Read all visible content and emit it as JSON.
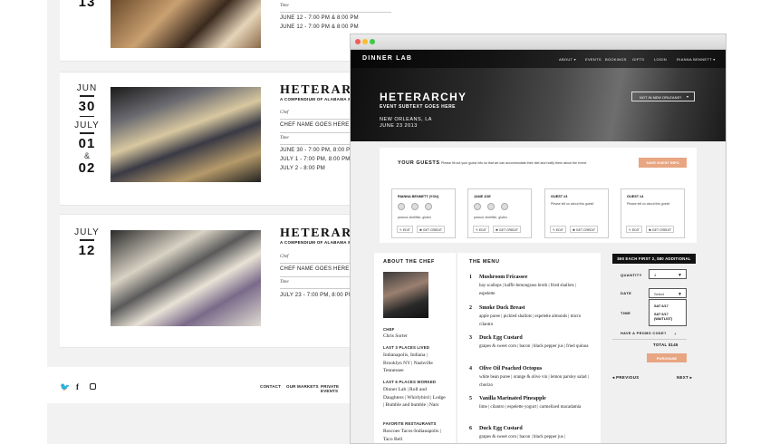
{
  "back_page": {
    "events": [
      {
        "month": "",
        "day": "13",
        "title": "",
        "subtitle": "",
        "chef_label": "",
        "chef_value": "",
        "time_label": "Time",
        "times": [
          "JUNE 12 - 7:00 PM & 8:00 PM",
          "JUNE 12 - 7:00 PM & 8:00 PM"
        ]
      },
      {
        "month": "JUN",
        "day": "30",
        "month2": "JULY",
        "day2": "01",
        "amp": "&",
        "day3": "02",
        "title": "HETERARCHY",
        "subtitle": "A COMPENDIUM OF ALABAMA ME",
        "chef_label": "Chef",
        "chef_value": "CHEF NAME GOES HERE",
        "time_label": "Time",
        "times": [
          "JUNE 30 - 7:00 PM, 8:00 PM",
          "JULY 1 - 7:00 PM, 8:00 PM",
          "JULY 2 - 8:00 PM"
        ]
      },
      {
        "month": "JULY",
        "day": "12",
        "title": "HETERARCHY",
        "subtitle": "A COMPENDIUM OF ALABAMA ME",
        "chef_label": "Chef",
        "chef_value": "CHEF NAME GOES HERE",
        "time_label": "Time",
        "times": [
          "JULY 23 - 7:00 PM, 8:00 PM"
        ]
      }
    ],
    "footer": {
      "links": [
        "CONTACT",
        "OUR MARKETS",
        "PRIVATE EVENTS"
      ],
      "icons": [
        "twitter-icon",
        "facebook-icon",
        "instagram-icon"
      ]
    }
  },
  "browser": {
    "nav": {
      "logo": "DINNER LAB",
      "links": [
        "ABOUT ▾",
        "EVENTS",
        "BOOKINGS",
        "GIFTS",
        "LOGIN",
        "RIANNA BENNETT ▾"
      ]
    },
    "hero": {
      "title": "HETERARCHY",
      "subtitle": "EVENT SUBTEXT GOES HERE",
      "city": "NEW ORLEANS, LA",
      "date": "JUNE 23 2013",
      "location_select": "NOT IN NEW ORLEANS?"
    },
    "guests": {
      "heading": "YOUR GUESTS",
      "instructions": "Please fill out your guest info so that we can accommodate their diet and notify them about the event.",
      "save_button": "SAVE GUEST INFO",
      "cards": [
        {
          "name": "RIANNA BENNETT (YOU)",
          "note": "peanut, shellfish, gluten",
          "edit": "EDIT",
          "credit": "GET CREDIT"
        },
        {
          "name": "JANE JOE",
          "note": "peanut, shellfish, gluten",
          "edit": "EDIT",
          "credit": "GET CREDIT"
        },
        {
          "name": "GUEST #3",
          "note": "Please tell us about this guest!",
          "edit": "EDIT",
          "credit": "GET CREDIT"
        },
        {
          "name": "GUEST #4",
          "note": "Please tell us about this guest!",
          "edit": "EDIT",
          "credit": "GET CREDIT"
        }
      ]
    },
    "chef": {
      "heading": "ABOUT THE CHEF",
      "chef_label": "CHEF",
      "chef_name": "Chris Sorter",
      "places_label": "LAST 3 PLACES LIVED",
      "places": "Indianapolis, Indiana | Brooklyn NY | Nashville Tennessee",
      "worked_label": "LAST 6 PLACES WORKED",
      "worked": "Dinner Lab | Roll and Daughters | Whirlybird | Lodge | Bumble and bumble | Nars",
      "fav_label": "FAVORITE RESTAURANTS",
      "fav": "Roscoes Tacos-Indianapolis | Taco Bell"
    },
    "menu": {
      "heading": "THE MENU",
      "items": [
        {
          "n": "1",
          "title": "Mushroom Fricassee",
          "desc": "bay scallops | kaffir-lemongrass broth | fried shallots | espelette"
        },
        {
          "n": "2",
          "title": "Smoke Duck Breast",
          "desc": "apple puree | pickled shallots | espelette almonds | micro cilantro"
        },
        {
          "n": "3",
          "title": "Duck Egg Custard",
          "desc": "grapes & sweet corn | bacon | black pepper jus | fried quinoa"
        },
        {
          "n": "4",
          "title": "Olive Oil Poached Octopus",
          "desc": "white bean puree | orange & olive vin | lemon parsley salad | chorizo"
        },
        {
          "n": "5",
          "title": "Vanilla Marinated Pineapple",
          "desc": "lime | cilantro | espelette yogurt | carmelized macadamia"
        },
        {
          "n": "6",
          "title": "Duck Egg Custard",
          "desc": "grapes & sweet corn | bacon | black pepper jus |"
        }
      ]
    },
    "order": {
      "price_banner": "$60 EACH FIRST 2, $80 ADDITIONAL",
      "quantity_label": "QUANTITY",
      "quantity_value": "4",
      "date_label": "DATE",
      "date_value": "Select",
      "date_options": [
        "SAT 6/17",
        "SAT 6/17 (WAITLIST)"
      ],
      "time_label": "TIME",
      "promo": "HAVE A PROMO CODE?",
      "total": "TOTAL $145",
      "purchase": "PURCHASE",
      "previous": "PREVIOUS",
      "next": "NEXT"
    }
  },
  "colors": {
    "accent": "#e8a582",
    "dark": "#111111"
  }
}
